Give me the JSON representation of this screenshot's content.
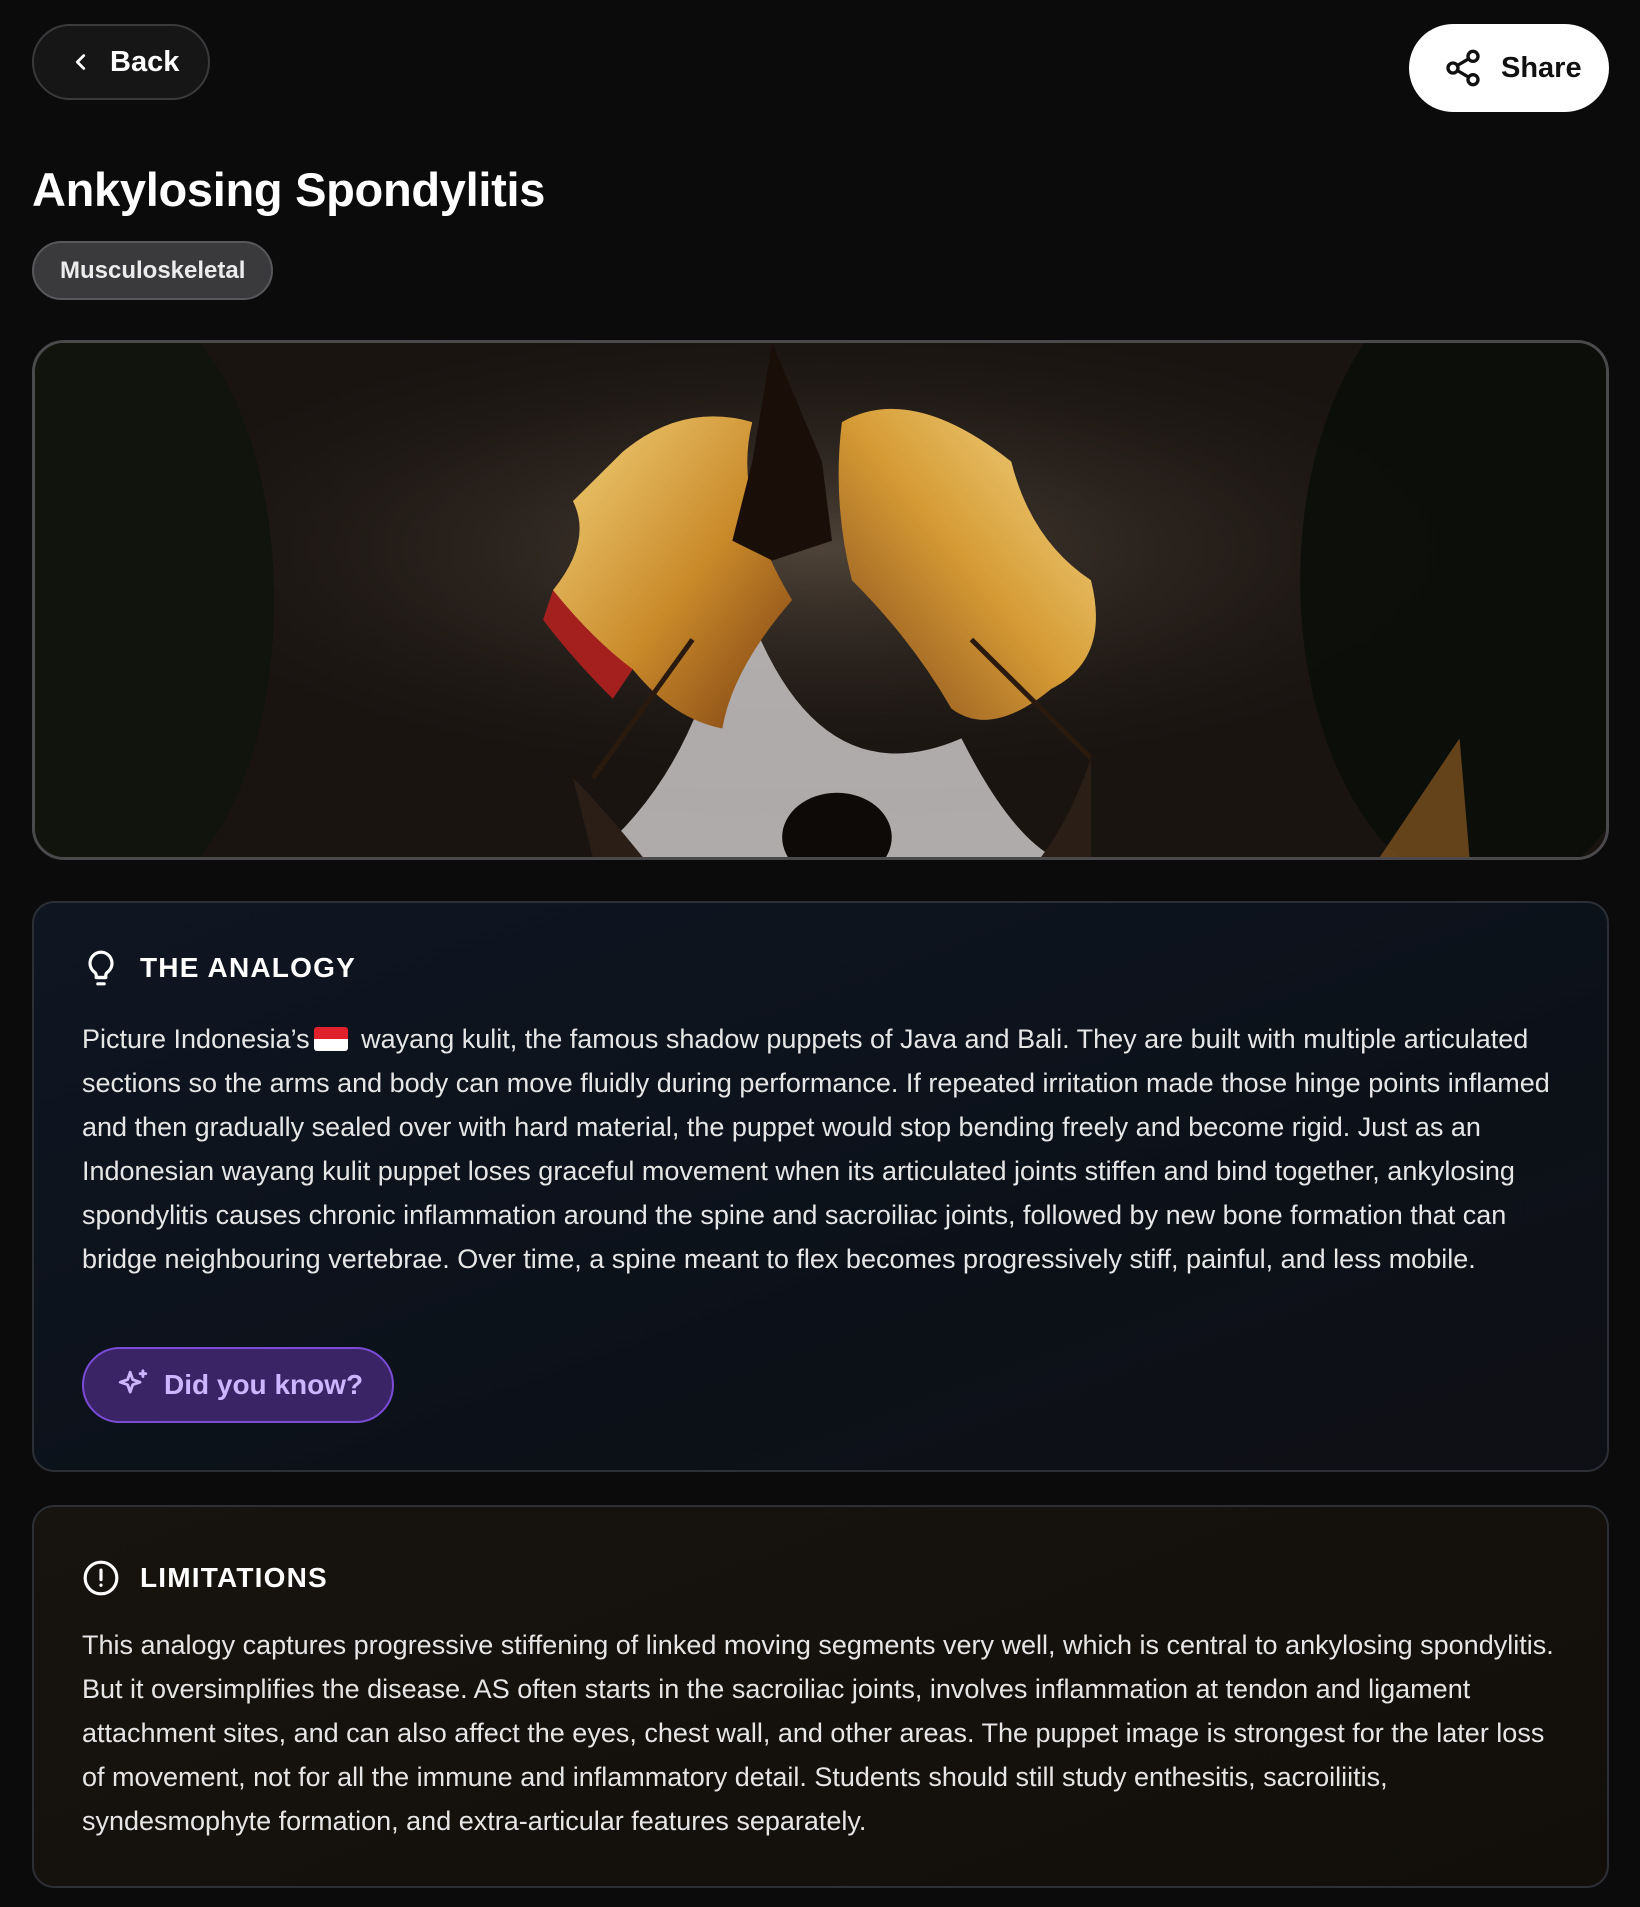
{
  "header": {
    "back_label": "Back",
    "share_label": "Share"
  },
  "page": {
    "title": "Ankylosing Spondylitis",
    "category": "Musculoskeletal"
  },
  "analogy": {
    "heading": "THE ANALOGY",
    "text_before_flag": "Picture Indonesia’s",
    "flag_icon": "indonesia-flag-icon",
    "text_after_flag": " wayang kulit, the famous shadow puppets of Java and Bali. They are built with multiple articulated sections so the arms and body can move fluidly during performance. If repeated irritation made those hinge points inflamed and then gradually sealed over with hard material, the puppet would stop bending freely and become rigid. Just as an Indonesian wayang kulit puppet loses graceful movement when its articulated joints stiffen and bind together, ankylosing spondylitis causes chronic inflammation around the spine and sacroiliac joints, followed by new bone formation that can bridge neighbouring vertebrae. Over time, a spine meant to flex becomes progressively stiff, painful, and less mobile.",
    "did_you_know_label": "Did you know?"
  },
  "limitations": {
    "heading": "LIMITATIONS",
    "text": "This analogy captures progressive stiffening of linked moving segments very well, which is central to ankylosing spondylitis. But it oversimplifies the disease. AS often starts in the sacroiliac joints, involves inflammation at tendon and ligament attachment sites, and can also affect the eyes, chest wall, and other areas. The puppet image is strongest for the later loss of movement, not for all the immune and inflammatory detail. Students should still study enthesitis, sacroiliitis, syndesmophyte formation, and extra-articular features separately."
  },
  "icons": {
    "back": "chevron-left-icon",
    "share": "share-icon",
    "analogy": "lightbulb-icon",
    "limitations": "alert-circle-icon",
    "did_you_know": "sparkles-icon"
  },
  "colors": {
    "background": "#0b0b0c",
    "accent_purple": "#7a4bd6",
    "flag_red": "#e0212b",
    "flag_white": "#ffffff"
  }
}
